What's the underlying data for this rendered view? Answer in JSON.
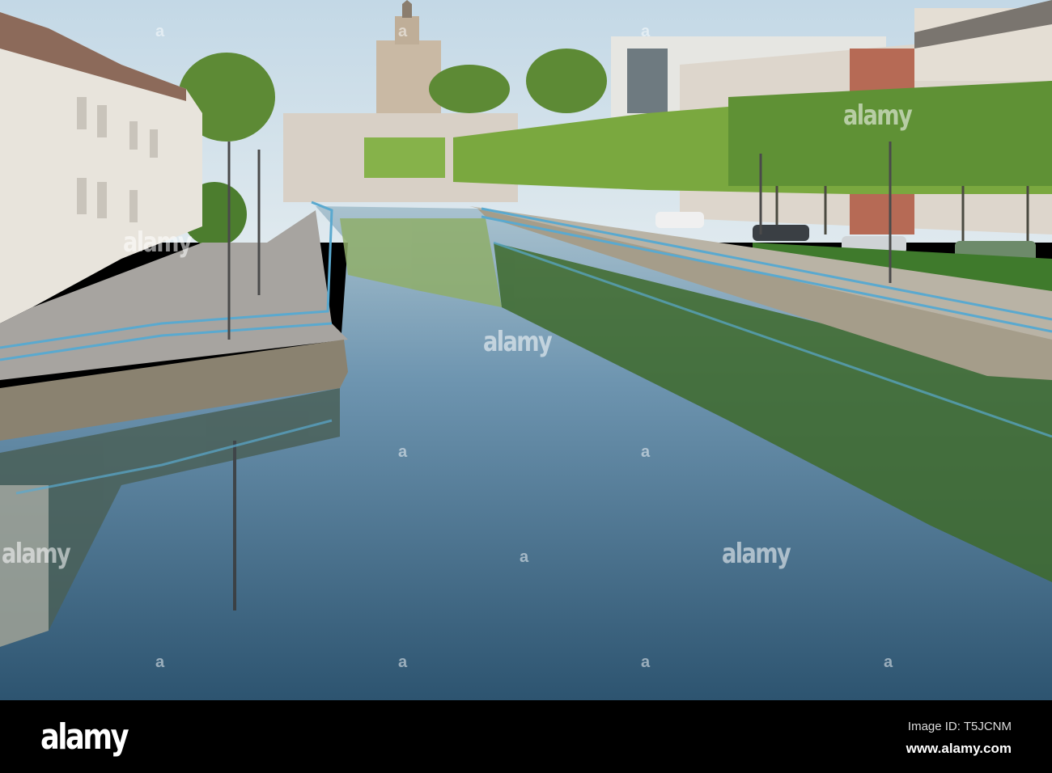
{
  "photo": {
    "subject": "canal-town-scene"
  },
  "watermark": {
    "text": "alamy",
    "mark": "a"
  },
  "footer": {
    "logo": "alamy",
    "image_id": "Image ID: T5JCNM",
    "url": "www.alamy.com"
  },
  "colors": {
    "sky": "#cfdfe8",
    "water_top": "#9ab6c8",
    "water_bottom": "#2d5470",
    "foliage": "#6f9a3a",
    "railing": "#5aa9cf"
  }
}
